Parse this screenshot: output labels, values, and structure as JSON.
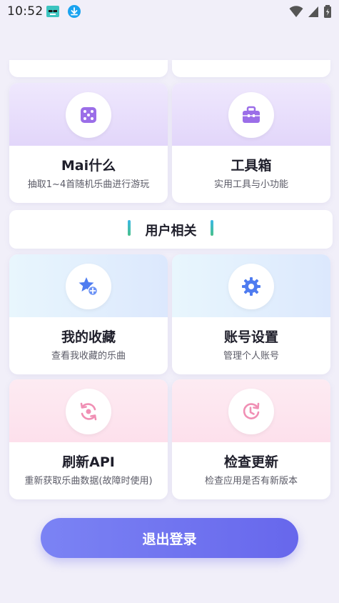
{
  "status_bar": {
    "time": "10:52",
    "icons": [
      "app-badge-icon",
      "download-icon",
      "wifi-icon",
      "signal-icon",
      "battery-icon"
    ]
  },
  "cards": {
    "mai": {
      "title": "Mai什么",
      "subtitle": "抽取1~4首随机乐曲进行游玩",
      "icon": "dice-icon"
    },
    "toolbox": {
      "title": "工具箱",
      "subtitle": "实用工具与小功能",
      "icon": "toolbox-icon"
    },
    "favorites": {
      "title": "我的收藏",
      "subtitle": "查看我收藏的乐曲",
      "icon": "star-add-icon"
    },
    "account": {
      "title": "账号设置",
      "subtitle": "管理个人账号",
      "icon": "gear-icon"
    },
    "refresh": {
      "title": "刷新API",
      "subtitle": "重新获取乐曲数据(故障时使用)",
      "icon": "refresh-icon"
    },
    "update": {
      "title": "检查更新",
      "subtitle": "检查应用是否有新版本",
      "icon": "clock-update-icon"
    }
  },
  "section": {
    "user_title": "用户相关"
  },
  "logout": {
    "label": "退出登录"
  },
  "colors": {
    "accent": "#6b6cee",
    "purple_tint": "#e6dcfb",
    "blue_tint": "#ddeafd",
    "pink_tint": "#fde4ee",
    "icon_purple": "#9b6ee8",
    "icon_blue": "#4f7cf0",
    "icon_pink": "#f08fb4"
  }
}
